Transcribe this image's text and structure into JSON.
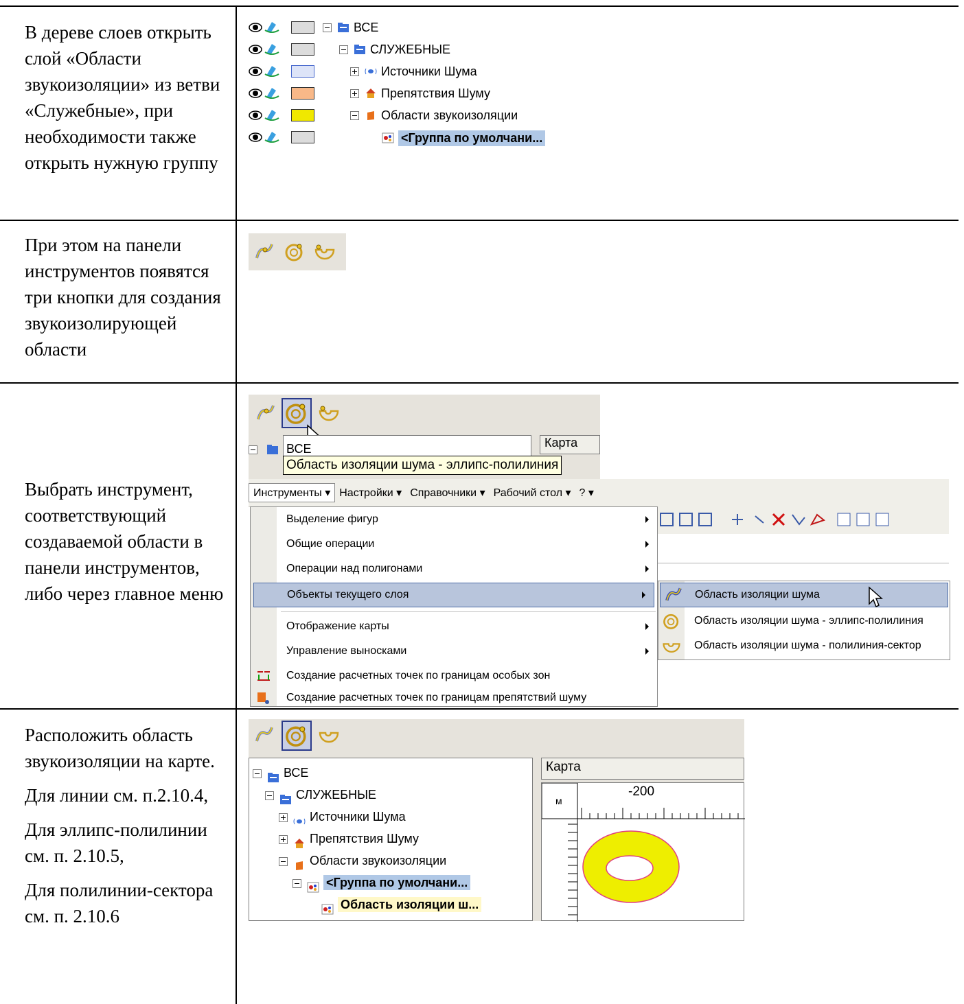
{
  "rows": [
    {
      "text": [
        "В дереве слоев открыть слой «Области звукоизоляции» из ветви «Служебные», при необходимости также открыть нужную группу"
      ]
    },
    {
      "text": [
        "При этом на панели инструментов появятся три кнопки для создания звукоизолирующей области"
      ]
    },
    {
      "text": [
        "Выбрать инструмент, соответствующий создаваемой области в панели инструментов, либо через главное меню"
      ]
    },
    {
      "text": [
        "Расположить область звукоизоляции на карте.",
        "Для линии см. п.2.10.4,",
        "Для эллипс-полилинии см. п. 2.10.5,",
        "Для полилинии-сектора см. п. 2.10.6"
      ]
    }
  ],
  "layer_tree": {
    "nodes": [
      {
        "label": "ВСЕ",
        "swatch": "#dcdcdc"
      },
      {
        "label": "СЛУЖЕБНЫЕ",
        "swatch": "#dcdcdc"
      },
      {
        "label": "Источники Шума",
        "swatch": "#dde4f8"
      },
      {
        "label": "Препятствия Шуму",
        "swatch": "#f8b888"
      },
      {
        "label": "Области звукоизоляции",
        "swatch": "#f0e800"
      },
      {
        "label": "<Группа по умолчани...",
        "swatch": "#dcdcdc"
      }
    ]
  },
  "tooltip": "Область изоляции шума - эллипс-полилиния",
  "partial_tree": {
    "root": "ВСЕ",
    "panel": "Карта"
  },
  "menubar": [
    "Инструменты ▾",
    "Настройки ▾",
    "Справочники ▾",
    "Рабочий стол ▾",
    "? ▾"
  ],
  "menu": {
    "items": [
      "Выделение фигур",
      "Общие операции",
      "Операции над полигонами",
      "Объекты текущего слоя",
      "Отображение карты",
      "Управление выносками",
      "Создание расчетных точек по границам особых зон",
      "Создание расчетных точек по границам препятствий шуму"
    ],
    "submenu": [
      "Область изоляции шума",
      "Область изоляции шума - эллипс-полилиния",
      "Область изоляции шума - полилиния-сектор"
    ]
  },
  "map_view": {
    "tree": [
      "ВСЕ",
      "СЛУЖЕБНЫЕ",
      "Источники Шума",
      "Препятствия Шуму",
      "Области звукоизоляции",
      "<Группа по умолчани...",
      "Область изоляции ш..."
    ],
    "panel_title": "Карта",
    "unit": "м",
    "ruler_label": "-200",
    "ring_fill": "#eeee00",
    "ring_stroke": "#e04080"
  },
  "colors": {
    "selection": "#b0c8e6",
    "toolbar": "#e6e3dc",
    "menu_hot": "#b8c5dc"
  }
}
